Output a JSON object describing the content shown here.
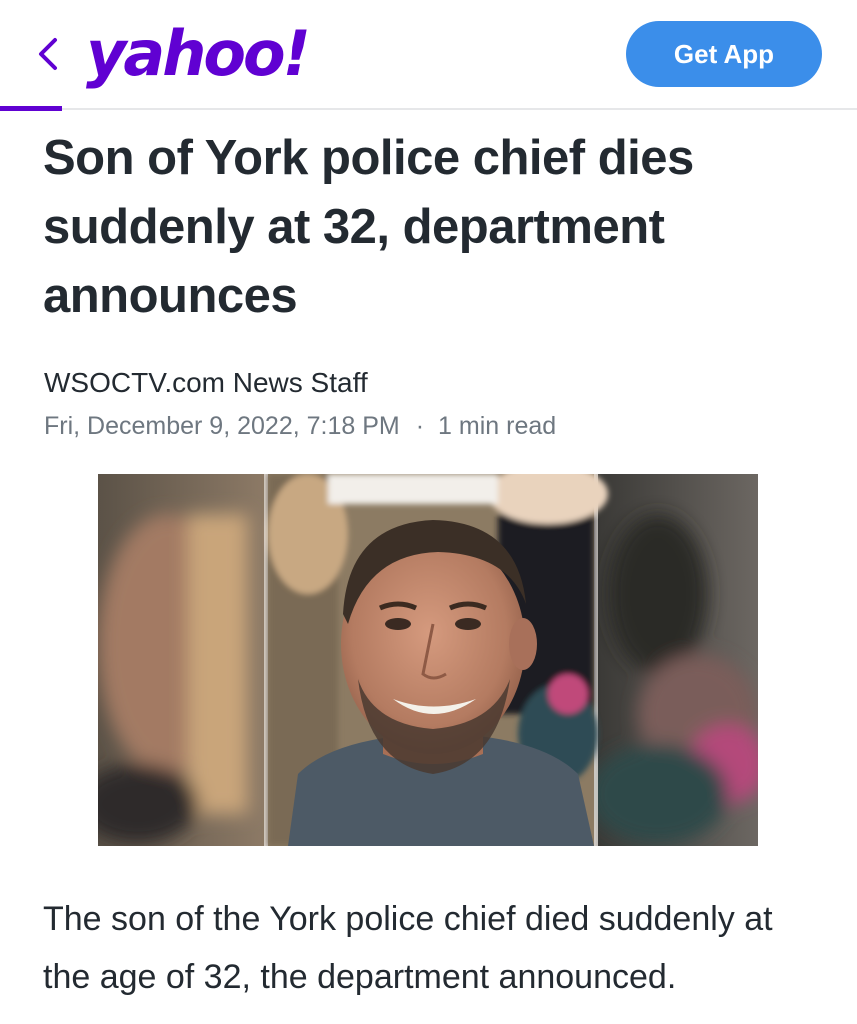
{
  "header": {
    "back_icon": "chevron-left-icon",
    "logo_text": "yahoo!",
    "get_app_label": "Get App",
    "brand_color": "#6001d2",
    "button_color": "#3b8eea"
  },
  "article": {
    "headline": "Son of York police chief dies suddenly at 32, department announces",
    "author": "WSOCTV.com News Staff",
    "date": "Fri, December 9, 2022, 7:18 PM",
    "separator": "·",
    "read_time": "1 min read",
    "body": "The son of the York police chief died suddenly at the age of 32, the department announced."
  }
}
